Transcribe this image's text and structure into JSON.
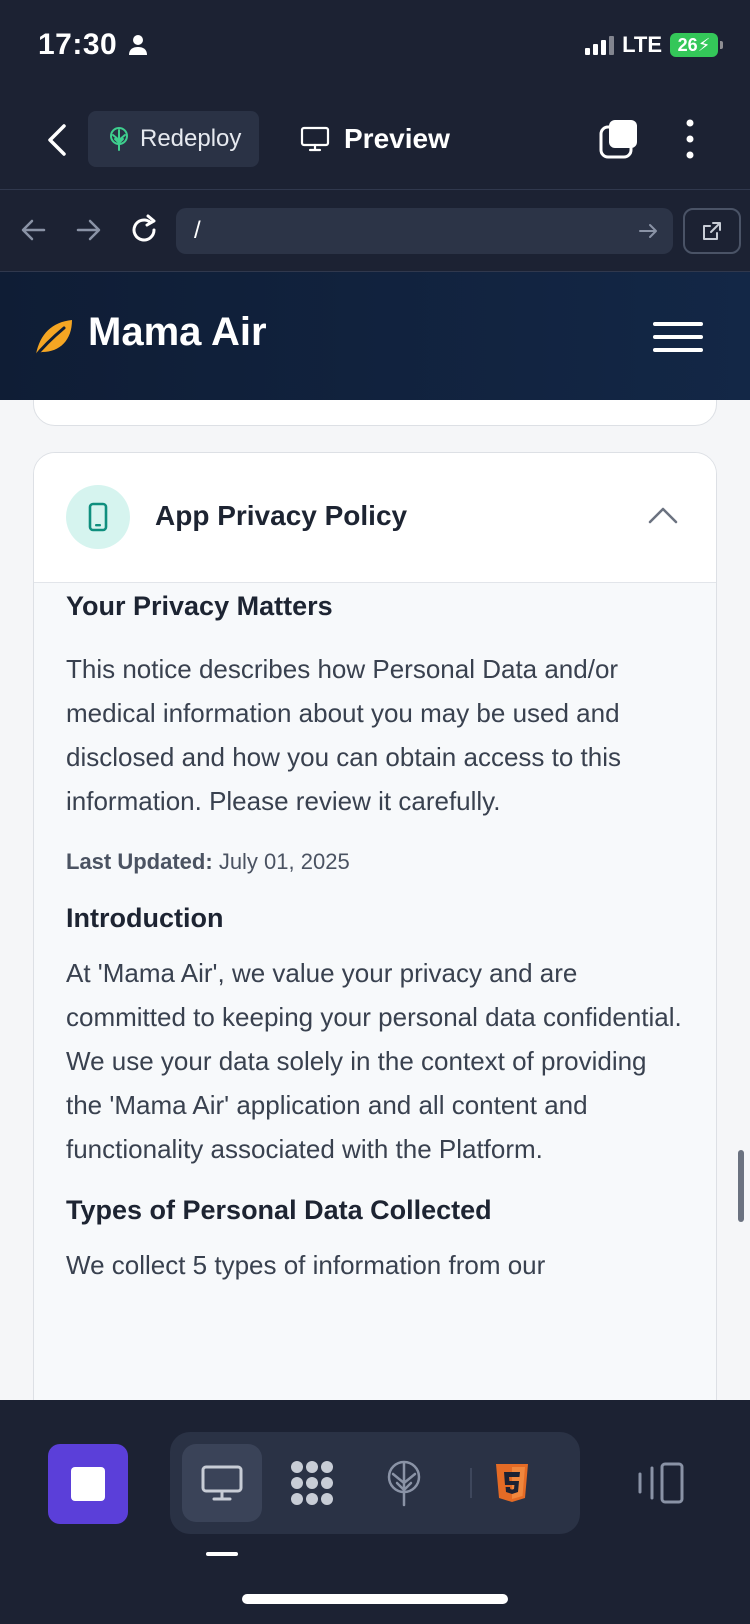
{
  "status_bar": {
    "time": "17:30",
    "network": "LTE",
    "battery": "26"
  },
  "toolbar": {
    "redeploy_label": "Redeploy",
    "preview_label": "Preview"
  },
  "url_bar": {
    "path": "/"
  },
  "site": {
    "title": "Mama Air",
    "accent_color": "#f5a623"
  },
  "card": {
    "title": "App Privacy Policy",
    "icon": "phone-icon",
    "sections": {
      "privacy_heading": "Your Privacy Matters",
      "privacy_text": "This notice describes how Personal Data and/or medical information about you may be used and disclosed and how you can obtain access to this information. Please review it carefully.",
      "updated_label": "Last Updated:",
      "updated_value": "July 01, 2025",
      "intro_heading": "Introduction",
      "intro_text": "At 'Mama Air', we value your privacy and are committed to keeping your personal data confidential. We use your data solely in the context of providing the 'Mama Air' application and all content and functionality associated with the Platform.",
      "types_heading": "Types of Personal Data Collected",
      "types_text": "We collect 5 types of information from our"
    }
  },
  "bottom_bar": {
    "items": [
      "monitor-icon",
      "apps-grid-icon",
      "deploy-tree-icon",
      "html5-icon"
    ],
    "primary_color": "#5b3fd9",
    "html5_color": "#e46b25"
  }
}
